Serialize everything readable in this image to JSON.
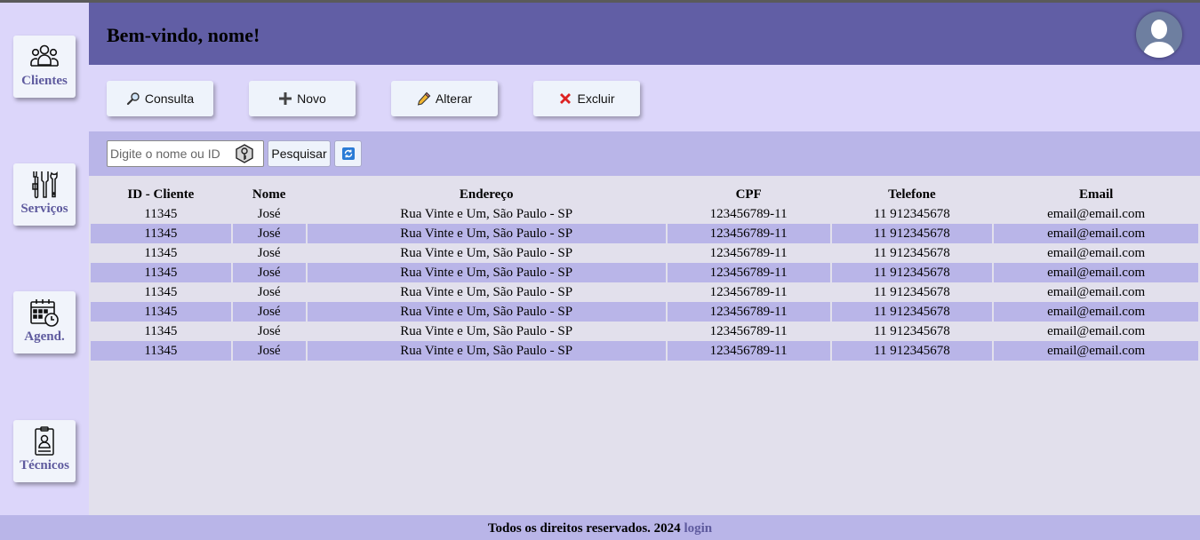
{
  "header": {
    "greeting": "Bem-vindo, nome!"
  },
  "sidebar": {
    "items": [
      {
        "label": "Clientes",
        "icon": "people-icon"
      },
      {
        "label": "Serviços",
        "icon": "tools-icon"
      },
      {
        "label": "Agend.",
        "icon": "calendar-clock-icon"
      },
      {
        "label": "Técnicos",
        "icon": "id-badge-icon"
      }
    ]
  },
  "actions": {
    "consulta": "Consulta",
    "novo": "Novo",
    "alterar": "Alterar",
    "excluir": "Excluir"
  },
  "search": {
    "placeholder": "Digite o nome ou ID",
    "button": "Pesquisar"
  },
  "table": {
    "headers": [
      "ID - Cliente",
      "Nome",
      "Endereço",
      "CPF",
      "Telefone",
      "Email"
    ],
    "rows": [
      [
        "11345",
        "José",
        "Rua Vinte e Um, São Paulo - SP",
        "123456789-11",
        "11 912345678",
        "email@email.com"
      ],
      [
        "11345",
        "José",
        "Rua Vinte e Um, São Paulo - SP",
        "123456789-11",
        "11 912345678",
        "email@email.com"
      ],
      [
        "11345",
        "José",
        "Rua Vinte e Um, São Paulo - SP",
        "123456789-11",
        "11 912345678",
        "email@email.com"
      ],
      [
        "11345",
        "José",
        "Rua Vinte e Um, São Paulo - SP",
        "123456789-11",
        "11 912345678",
        "email@email.com"
      ],
      [
        "11345",
        "José",
        "Rua Vinte e Um, São Paulo - SP",
        "123456789-11",
        "11 912345678",
        "email@email.com"
      ],
      [
        "11345",
        "José",
        "Rua Vinte e Um, São Paulo - SP",
        "123456789-11",
        "11 912345678",
        "email@email.com"
      ],
      [
        "11345",
        "José",
        "Rua Vinte e Um, São Paulo - SP",
        "123456789-11",
        "11 912345678",
        "email@email.com"
      ],
      [
        "11345",
        "José",
        "Rua Vinte e Um, São Paulo - SP",
        "123456789-11",
        "11 912345678",
        "email@email.com"
      ]
    ]
  },
  "footer": {
    "text": "Todos os direitos reservados. 2024",
    "link": "login"
  },
  "colors": {
    "header": "#615ea5",
    "sidebar": "#dcd6fa",
    "band": "#b9b5e8",
    "content": "#e2e0ec",
    "accent_text": "#5e5a9e"
  }
}
